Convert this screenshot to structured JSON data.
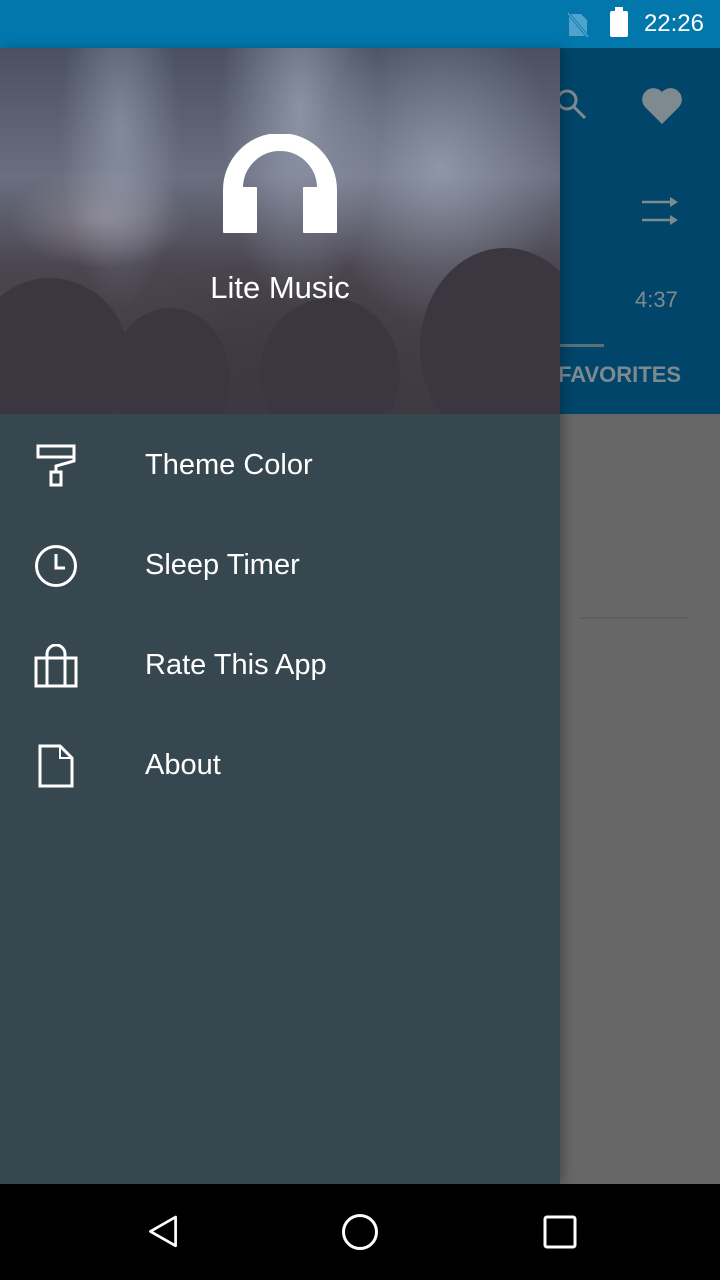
{
  "status_bar": {
    "time": "22:26",
    "icons": [
      "no-sim-icon",
      "battery-full-icon"
    ],
    "background_color": "#0277ac"
  },
  "background_app": {
    "header_color": "#01466a",
    "icons": [
      "search-icon",
      "heart-icon",
      "shuffle-icon"
    ],
    "track_duration": "4:37",
    "visible_tab": "FAVORITES"
  },
  "drawer": {
    "background_color": "#37474f",
    "header": {
      "logo_icon": "headphones-icon",
      "title": "Lite Music"
    },
    "items": [
      {
        "label": "Theme Color",
        "icon": "paint-roller-icon"
      },
      {
        "label": "Sleep Timer",
        "icon": "clock-icon"
      },
      {
        "label": "Rate This App",
        "icon": "shopping-bag-icon"
      },
      {
        "label": "About",
        "icon": "document-icon"
      }
    ]
  },
  "nav_bar": {
    "buttons": [
      "back-icon",
      "home-icon",
      "recents-icon"
    ]
  }
}
